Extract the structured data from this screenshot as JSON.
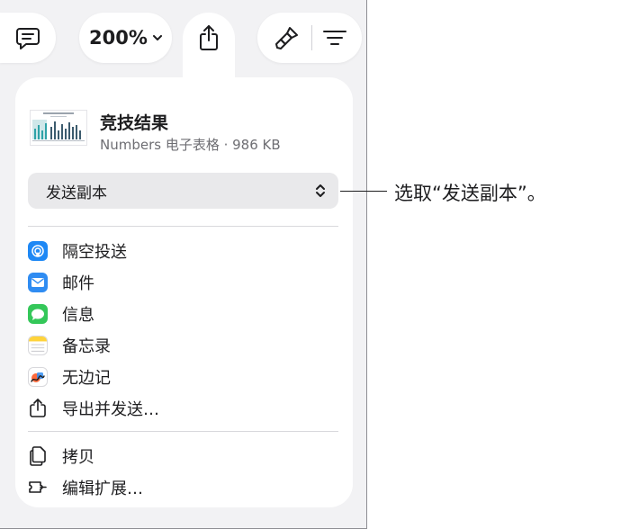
{
  "toolbar": {
    "zoom_label": "200%"
  },
  "document": {
    "title": "竞技结果",
    "subtitle": "Numbers 电子表格 · 986 KB"
  },
  "send_select": {
    "value": "发送副本"
  },
  "share_targets": [
    {
      "label": "隔空投送",
      "icon": "airdrop-icon",
      "color": "#1e88f5"
    },
    {
      "label": "邮件",
      "icon": "mail-icon",
      "color": "#2f8cf2"
    },
    {
      "label": "信息",
      "icon": "messages-icon",
      "color": "#34c759"
    },
    {
      "label": "备忘录",
      "icon": "notes-icon",
      "color": "#ffd33a"
    },
    {
      "label": "无边记",
      "icon": "freeform-icon",
      "color": "#ff6a3d"
    },
    {
      "label": "导出并发送…",
      "icon": "export-icon",
      "color": "#1d1d1f"
    }
  ],
  "actions": [
    {
      "label": "拷贝",
      "icon": "copy-icon"
    },
    {
      "label": "编辑扩展…",
      "icon": "extension-icon"
    }
  ],
  "callout": {
    "text": "选取“发送副本”。"
  }
}
